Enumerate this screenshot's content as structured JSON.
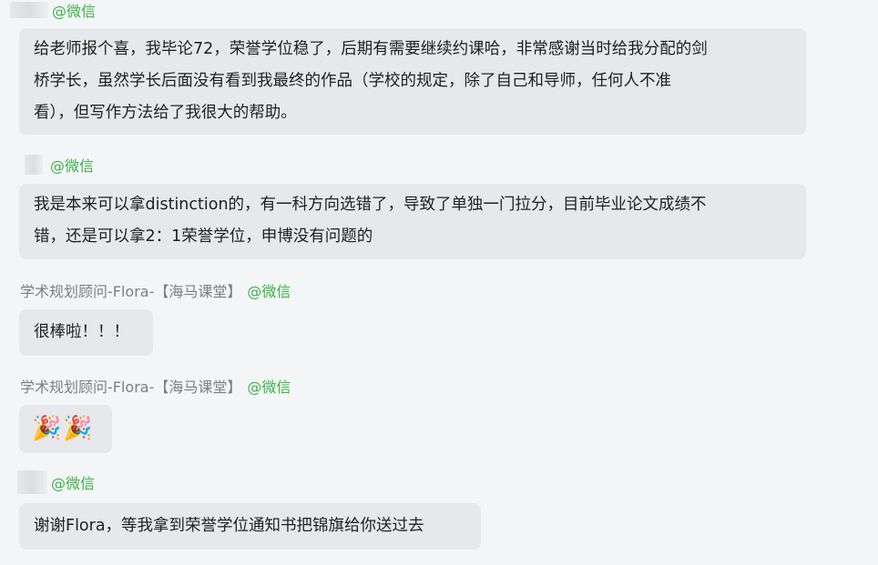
{
  "messages": [
    {
      "sender_name": "",
      "channel": "@微信",
      "lines": [
        "给老师报个喜，我毕论72，荣誉学位稳了，后期有需要继续约课哈，非常感谢当时给我分配的剑",
        "桥学长，虽然学长后面没有看到我最终的作品（学校的规定，除了自己和导师，任何人不准",
        "看），但写作方法给了我很大的帮助。"
      ]
    },
    {
      "sender_name": "",
      "channel": "@微信",
      "lines": [
        "我是本来可以拿distinction的，有一科方向选错了，导致了单独一门拉分，目前毕业论文成绩不",
        "错，还是可以拿2：1荣誉学位，申博没有问题的"
      ]
    },
    {
      "sender_name": "学术规划顾问-Flora-【海马课堂】",
      "channel": "@微信",
      "lines": [
        "很棒啦！！！"
      ]
    },
    {
      "sender_name": "学术规划顾问-Flora-【海马课堂】",
      "channel": "@微信",
      "lines": [
        "🎉🎉"
      ]
    },
    {
      "sender_name": "",
      "channel": "@微信",
      "lines": [
        "谢谢Flora，等我拿到荣誉学位通知书把锦旗给你送过去"
      ]
    }
  ]
}
